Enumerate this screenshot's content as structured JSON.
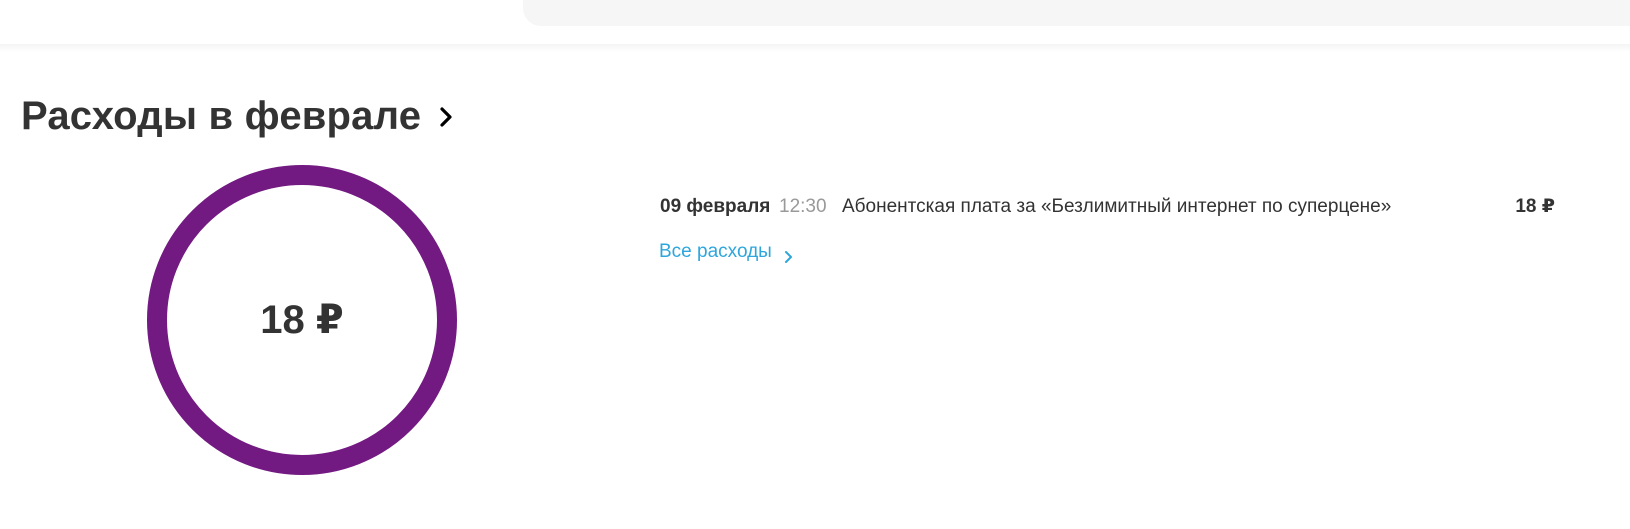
{
  "header": {
    "title": "Расходы в феврале"
  },
  "donut": {
    "total": "18 ₽",
    "color": "#731982",
    "fraction": 1.0
  },
  "expenses": [
    {
      "date": "09 февраля",
      "time": "12:30",
      "description": "Абонентская плата за «Безлимитный интернет по суперцене»",
      "amount": "18 ₽"
    }
  ],
  "all_expenses_link": {
    "label": "Все расходы",
    "color": "#2ea6dd"
  },
  "icons": {
    "header_chevron": "chevron-right-icon",
    "link_chevron": "chevron-right-icon"
  }
}
